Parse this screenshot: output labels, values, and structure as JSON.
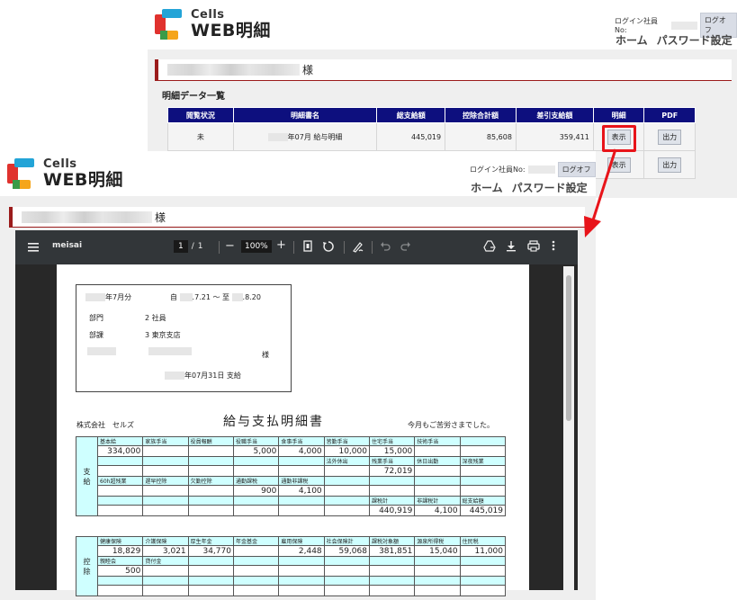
{
  "app": {
    "logo_line1": "Cells",
    "logo_line2": "WEB明細"
  },
  "header": {
    "login_label": "ログイン社員No:",
    "logout_label": "ログオフ",
    "nav_home": "ホーム",
    "nav_password": "パスワード設定"
  },
  "user": {
    "honorific": "様"
  },
  "list": {
    "title": "明細データ一覧",
    "columns": [
      "閲覧状況",
      "明細書名",
      "総支給額",
      "控除合計額",
      "差引支給額",
      "明細",
      "PDF"
    ],
    "rows": [
      {
        "status": "未",
        "name": "年07月 給与明細",
        "gross": "445,019",
        "deduction": "85,608",
        "net": "359,411",
        "detail_button": "表示",
        "pdf_button": "出力"
      },
      {
        "detail_button": "表示",
        "pdf_button": "出力"
      }
    ]
  },
  "colors": {
    "accent": "#9b1b1b",
    "table_header": "#0d0f7e",
    "highlight": "#e8141a",
    "cell_label_bg": "#cfffff"
  },
  "viewer": {
    "filename": "meisai",
    "page_current": "1",
    "page_sep": "/",
    "page_total": "1",
    "zoom_minus": "−",
    "zoom": "100%",
    "zoom_plus": "+"
  },
  "pdf": {
    "period": "年7月分",
    "from_label": "自",
    "from_date": ".7.21",
    "tilde": "～",
    "to_label": "至",
    "to_date": ".8.20",
    "dept_label": "部門",
    "dept_value": "2 社員",
    "section_label": "部課",
    "section_value": "3 東京支店",
    "honorific": "様",
    "pay_date": "年07月31日 支給",
    "company": "株式会社　セルズ",
    "doc_title": "給与支払明細書",
    "greeting": "今月もご苦労さまでした。",
    "payment_side": "支\n給",
    "deduction_side": "控\n除",
    "payment": [
      {
        "labels": [
          "基本給",
          "家族手当",
          "役員報酬",
          "役職手当",
          "食事手当",
          "皆勤手当",
          "住宅手当",
          "技術手当",
          ""
        ],
        "values": [
          "334,000",
          "",
          "",
          "5,000",
          "4,000",
          "10,000",
          "15,000",
          "",
          ""
        ]
      },
      {
        "labels": [
          "",
          "",
          "",
          "",
          "",
          "法外休出",
          "残業手当",
          "休日出勤",
          "深夜残業"
        ],
        "values": [
          "",
          "",
          "",
          "",
          "",
          "",
          "72,019",
          "",
          ""
        ]
      },
      {
        "labels": [
          "60h超残業",
          "遅早控除",
          "欠勤控除",
          "通勤課税",
          "通勤非課税",
          "",
          "",
          "",
          ""
        ],
        "values": [
          "",
          "",
          "",
          "900",
          "4,100",
          "",
          "",
          "",
          ""
        ]
      },
      {
        "labels": [
          "",
          "",
          "",
          "",
          "",
          "",
          "課税計",
          "非課税計",
          "総支給額"
        ],
        "values": [
          "",
          "",
          "",
          "",
          "",
          "",
          "440,919",
          "4,100",
          "445,019"
        ]
      }
    ],
    "deduction": [
      {
        "labels": [
          "健康保険",
          "介護保険",
          "厚生年金",
          "年金基金",
          "雇用保険",
          "社会保険計",
          "課税対象額",
          "源泉所得税",
          "住民税"
        ],
        "values": [
          "18,829",
          "3,021",
          "34,770",
          "",
          "2,448",
          "59,068",
          "381,851",
          "15,040",
          "11,000"
        ]
      },
      {
        "labels": [
          "親睦会",
          "貸付金",
          "",
          "",
          "",
          "",
          "",
          "",
          ""
        ],
        "values": [
          "500",
          "",
          "",
          "",
          "",
          "",
          "",
          "",
          ""
        ]
      },
      {
        "labels": [
          "",
          "",
          "",
          "",
          "",
          "",
          "",
          "",
          ""
        ],
        "values": [
          "",
          "",
          "",
          "",
          "",
          "",
          "",
          "",
          ""
        ]
      }
    ]
  }
}
